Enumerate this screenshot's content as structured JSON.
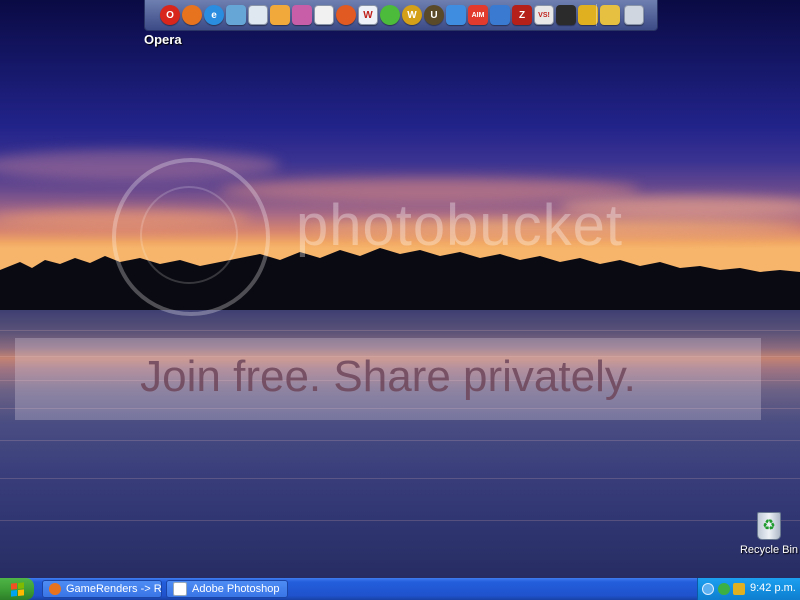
{
  "dock": {
    "hover_label": "Opera",
    "icons": [
      {
        "name": "opera-icon",
        "glyph": "O",
        "color": "#d8261c",
        "round": true
      },
      {
        "name": "firefox-icon",
        "glyph": "",
        "color": "#e8731f",
        "round": true
      },
      {
        "name": "internet-explorer-icon",
        "glyph": "e",
        "color": "#2a8de0",
        "round": true
      },
      {
        "name": "messenger-icon",
        "glyph": "",
        "color": "#66a6d6",
        "round": false
      },
      {
        "name": "document-icon",
        "glyph": "",
        "color": "#dfe7f1",
        "round": false
      },
      {
        "name": "flower-icon",
        "glyph": "",
        "color": "#f2a93b",
        "round": false
      },
      {
        "name": "paint-icon",
        "glyph": "",
        "color": "#c85ea8",
        "round": false
      },
      {
        "name": "pdf-reader-icon",
        "glyph": "",
        "color": "#f1f1f1",
        "round": false
      },
      {
        "name": "media-player-icon",
        "glyph": "",
        "color": "#e05a22",
        "round": true
      },
      {
        "name": "word-icon",
        "glyph": "W",
        "color": "#eef1f7",
        "round": false
      },
      {
        "name": "green-app-icon",
        "glyph": "",
        "color": "#4cbb3c",
        "round": true
      },
      {
        "name": "w-badge-icon",
        "glyph": "W",
        "color": "#d4a017",
        "round": true
      },
      {
        "name": "u-badge-icon",
        "glyph": "U",
        "color": "#5a4a2a",
        "round": true
      },
      {
        "name": "contacts-icon",
        "glyph": "",
        "color": "#3f8de0",
        "round": false
      },
      {
        "name": "aim-icon",
        "glyph": "AIM",
        "color": "#e23a2c",
        "round": false
      },
      {
        "name": "network-icon",
        "glyph": "",
        "color": "#3a7ad0",
        "round": false
      },
      {
        "name": "filezilla-icon",
        "glyph": "Z",
        "color": "#b5201a",
        "round": false
      },
      {
        "name": "vs-icon",
        "glyph": "VS!",
        "color": "#e8e8e8",
        "round": false
      },
      {
        "name": "terminal-icon",
        "glyph": "",
        "color": "#2b2b2b",
        "round": false
      },
      {
        "name": "lightning-app-icon",
        "glyph": "",
        "color": "#e0b020",
        "round": false
      },
      {
        "name": "tools-icon",
        "glyph": "",
        "color": "#e6c040",
        "round": false
      },
      {
        "name": "trash-icon",
        "glyph": "",
        "color": "#cfd6e0",
        "round": false
      }
    ]
  },
  "watermark": {
    "brand": "photobucket",
    "banner": "Join free. Share privately."
  },
  "desktop": {
    "recycle_bin_label": "Recycle Bin"
  },
  "taskbar": {
    "tasks": [
      {
        "label": "GameRenders -> Repl...",
        "icon_color": "#e8731f"
      },
      {
        "label": "Adobe Photoshop",
        "icon_color": "#ffffff"
      }
    ],
    "clock": "9:42 p.m."
  },
  "colors": {
    "taskbar_blue": "#245edc",
    "start_green": "#3a9a33",
    "tray_blue": "#138fe0"
  }
}
